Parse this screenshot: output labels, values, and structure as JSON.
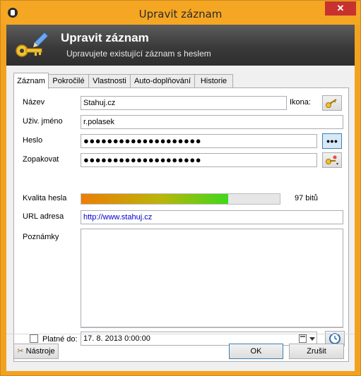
{
  "window": {
    "title": "Upravit záznam"
  },
  "banner": {
    "title": "Upravit záznam",
    "subtitle": "Upravujete existující záznam s heslem"
  },
  "tabs": [
    {
      "label": "Záznam",
      "active": true
    },
    {
      "label": "Pokročilé"
    },
    {
      "label": "Vlastnosti"
    },
    {
      "label": "Auto-doplňování"
    },
    {
      "label": "Historie"
    }
  ],
  "form": {
    "name_label": "Název",
    "name_value": "Stahuj.cz",
    "icon_label": "Ikona:",
    "user_label": "Uživ. jméno",
    "user_value": "r.polasek",
    "password_label": "Heslo",
    "password_value": "●●●●●●●●●●●●●●●●●●●●",
    "password_toggle": "●●●",
    "repeat_label": "Zopakovat",
    "repeat_value": "●●●●●●●●●●●●●●●●●●●●",
    "quality_label": "Kvalita hesla",
    "quality_text": "97 bitů",
    "quality_percent": 74,
    "url_label": "URL adresa",
    "url_value": "http://www.stahuj.cz",
    "notes_label": "Poznámky",
    "notes_value": "",
    "expires_label": "Platné do:",
    "expires_value": "17.   8. 2013   0:00:00",
    "expires_checked": false
  },
  "buttons": {
    "tools": "Nástroje",
    "ok": "OK",
    "cancel": "Zrušit"
  },
  "colors": {
    "title_bar": "#f5a623",
    "banner": "#3a3a3a",
    "url_text": "#0000cc",
    "close_button": "#c7312e"
  }
}
